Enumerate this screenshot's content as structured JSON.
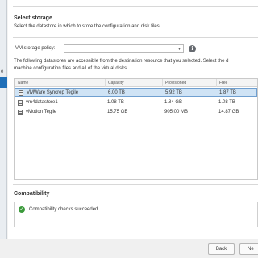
{
  "nav": {
    "active_label": ""
  },
  "page": {
    "title": "Select storage",
    "subtitle": "Select the datastore in which to store the configuration and disk files"
  },
  "policy": {
    "label": "VM storage policy:",
    "value": "",
    "info_icon": "info-icon"
  },
  "description": {
    "line1": "The following datastores are accessible from the destination resource that you selected. Select the d",
    "line2": "machine configuration files and all of the virtual disks."
  },
  "table": {
    "columns": [
      "Name",
      "Capacity",
      "Provisioned",
      "Free"
    ],
    "rows": [
      {
        "name": "VMWare Syncrep Tegile",
        "capacity": "6.00 TB",
        "provisioned": "5.92 TB",
        "free": "1.87 TB",
        "selected": true
      },
      {
        "name": "vm4datastore1",
        "capacity": "1.08 TB",
        "provisioned": "1.84 GB",
        "free": "1.08 TB",
        "selected": false
      },
      {
        "name": "vMotion Tegile",
        "capacity": "15.75 GB",
        "provisioned": "905.00 MB",
        "free": "14.87 GB",
        "selected": false
      }
    ]
  },
  "compatibility": {
    "title": "Compatibility",
    "message": "Compatibility checks succeeded.",
    "status_icon": "check-circle-icon",
    "status_color": "#3b9a3b"
  },
  "footer": {
    "back_label": "Back",
    "next_label": "Ne"
  },
  "colors": {
    "accent": "#1f6fb8",
    "selected_row": "#cfe3f5"
  }
}
